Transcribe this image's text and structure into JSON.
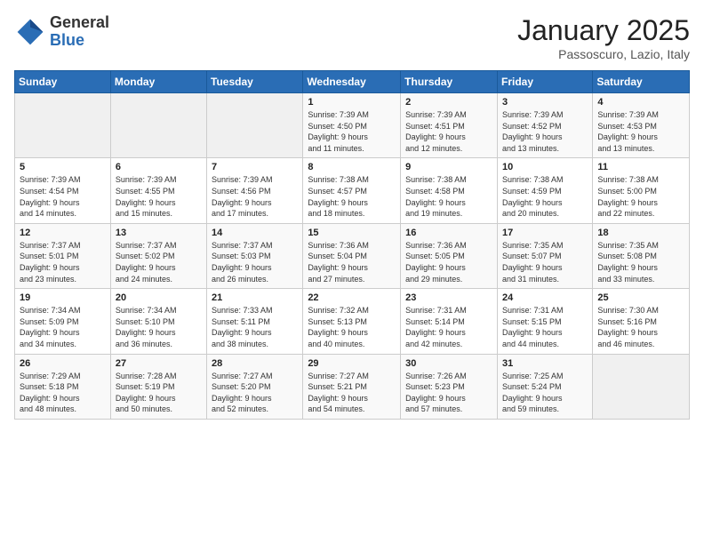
{
  "logo": {
    "general": "General",
    "blue": "Blue"
  },
  "title": "January 2025",
  "subtitle": "Passoscuro, Lazio, Italy",
  "days_header": [
    "Sunday",
    "Monday",
    "Tuesday",
    "Wednesday",
    "Thursday",
    "Friday",
    "Saturday"
  ],
  "weeks": [
    [
      {
        "day": "",
        "info": ""
      },
      {
        "day": "",
        "info": ""
      },
      {
        "day": "",
        "info": ""
      },
      {
        "day": "1",
        "info": "Sunrise: 7:39 AM\nSunset: 4:50 PM\nDaylight: 9 hours\nand 11 minutes."
      },
      {
        "day": "2",
        "info": "Sunrise: 7:39 AM\nSunset: 4:51 PM\nDaylight: 9 hours\nand 12 minutes."
      },
      {
        "day": "3",
        "info": "Sunrise: 7:39 AM\nSunset: 4:52 PM\nDaylight: 9 hours\nand 13 minutes."
      },
      {
        "day": "4",
        "info": "Sunrise: 7:39 AM\nSunset: 4:53 PM\nDaylight: 9 hours\nand 13 minutes."
      }
    ],
    [
      {
        "day": "5",
        "info": "Sunrise: 7:39 AM\nSunset: 4:54 PM\nDaylight: 9 hours\nand 14 minutes."
      },
      {
        "day": "6",
        "info": "Sunrise: 7:39 AM\nSunset: 4:55 PM\nDaylight: 9 hours\nand 15 minutes."
      },
      {
        "day": "7",
        "info": "Sunrise: 7:39 AM\nSunset: 4:56 PM\nDaylight: 9 hours\nand 17 minutes."
      },
      {
        "day": "8",
        "info": "Sunrise: 7:38 AM\nSunset: 4:57 PM\nDaylight: 9 hours\nand 18 minutes."
      },
      {
        "day": "9",
        "info": "Sunrise: 7:38 AM\nSunset: 4:58 PM\nDaylight: 9 hours\nand 19 minutes."
      },
      {
        "day": "10",
        "info": "Sunrise: 7:38 AM\nSunset: 4:59 PM\nDaylight: 9 hours\nand 20 minutes."
      },
      {
        "day": "11",
        "info": "Sunrise: 7:38 AM\nSunset: 5:00 PM\nDaylight: 9 hours\nand 22 minutes."
      }
    ],
    [
      {
        "day": "12",
        "info": "Sunrise: 7:37 AM\nSunset: 5:01 PM\nDaylight: 9 hours\nand 23 minutes."
      },
      {
        "day": "13",
        "info": "Sunrise: 7:37 AM\nSunset: 5:02 PM\nDaylight: 9 hours\nand 24 minutes."
      },
      {
        "day": "14",
        "info": "Sunrise: 7:37 AM\nSunset: 5:03 PM\nDaylight: 9 hours\nand 26 minutes."
      },
      {
        "day": "15",
        "info": "Sunrise: 7:36 AM\nSunset: 5:04 PM\nDaylight: 9 hours\nand 27 minutes."
      },
      {
        "day": "16",
        "info": "Sunrise: 7:36 AM\nSunset: 5:05 PM\nDaylight: 9 hours\nand 29 minutes."
      },
      {
        "day": "17",
        "info": "Sunrise: 7:35 AM\nSunset: 5:07 PM\nDaylight: 9 hours\nand 31 minutes."
      },
      {
        "day": "18",
        "info": "Sunrise: 7:35 AM\nSunset: 5:08 PM\nDaylight: 9 hours\nand 33 minutes."
      }
    ],
    [
      {
        "day": "19",
        "info": "Sunrise: 7:34 AM\nSunset: 5:09 PM\nDaylight: 9 hours\nand 34 minutes."
      },
      {
        "day": "20",
        "info": "Sunrise: 7:34 AM\nSunset: 5:10 PM\nDaylight: 9 hours\nand 36 minutes."
      },
      {
        "day": "21",
        "info": "Sunrise: 7:33 AM\nSunset: 5:11 PM\nDaylight: 9 hours\nand 38 minutes."
      },
      {
        "day": "22",
        "info": "Sunrise: 7:32 AM\nSunset: 5:13 PM\nDaylight: 9 hours\nand 40 minutes."
      },
      {
        "day": "23",
        "info": "Sunrise: 7:31 AM\nSunset: 5:14 PM\nDaylight: 9 hours\nand 42 minutes."
      },
      {
        "day": "24",
        "info": "Sunrise: 7:31 AM\nSunset: 5:15 PM\nDaylight: 9 hours\nand 44 minutes."
      },
      {
        "day": "25",
        "info": "Sunrise: 7:30 AM\nSunset: 5:16 PM\nDaylight: 9 hours\nand 46 minutes."
      }
    ],
    [
      {
        "day": "26",
        "info": "Sunrise: 7:29 AM\nSunset: 5:18 PM\nDaylight: 9 hours\nand 48 minutes."
      },
      {
        "day": "27",
        "info": "Sunrise: 7:28 AM\nSunset: 5:19 PM\nDaylight: 9 hours\nand 50 minutes."
      },
      {
        "day": "28",
        "info": "Sunrise: 7:27 AM\nSunset: 5:20 PM\nDaylight: 9 hours\nand 52 minutes."
      },
      {
        "day": "29",
        "info": "Sunrise: 7:27 AM\nSunset: 5:21 PM\nDaylight: 9 hours\nand 54 minutes."
      },
      {
        "day": "30",
        "info": "Sunrise: 7:26 AM\nSunset: 5:23 PM\nDaylight: 9 hours\nand 57 minutes."
      },
      {
        "day": "31",
        "info": "Sunrise: 7:25 AM\nSunset: 5:24 PM\nDaylight: 9 hours\nand 59 minutes."
      },
      {
        "day": "",
        "info": ""
      }
    ]
  ]
}
